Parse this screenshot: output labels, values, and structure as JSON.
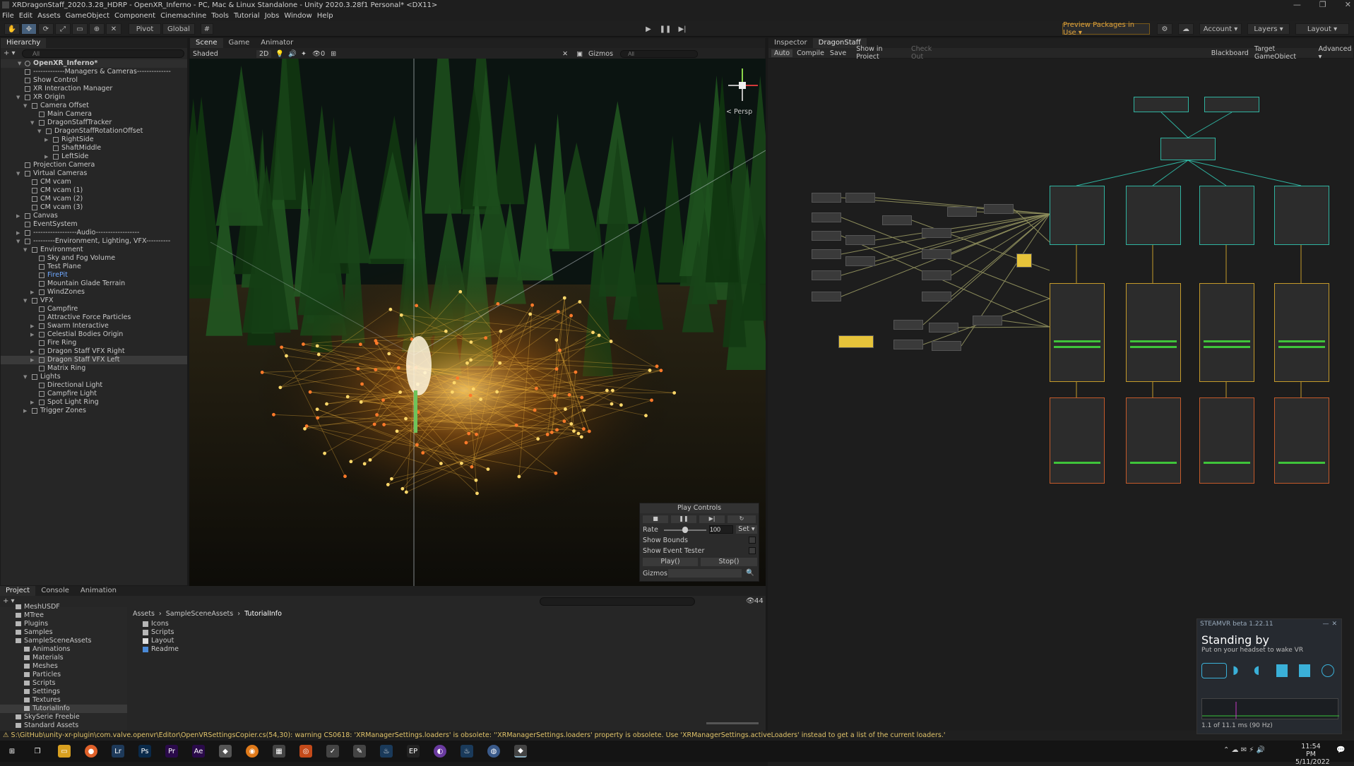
{
  "window": {
    "title": "XRDragonStaff_2020.3.28_HDRP - OpenXR_Inferno - PC, Mac & Linux Standalone - Unity 2020.3.28f1 Personal* <DX11>",
    "controls": [
      "—",
      "❐",
      "✕"
    ]
  },
  "menu": [
    "File",
    "Edit",
    "Assets",
    "GameObject",
    "Component",
    "Cinemachine",
    "Tools",
    "Tutorial",
    "Jobs",
    "Window",
    "Help"
  ],
  "toolbar": {
    "pivot": "Pivot",
    "global": "Global",
    "preview_packages": "Preview Packages in Use ▾",
    "account": "Account",
    "layers": "Layers",
    "layout": "Layout"
  },
  "hierarchy": {
    "tab": "Hierarchy",
    "search_placeholder": "All",
    "scene_name": "OpenXR_Inferno*",
    "items": [
      {
        "label": "-------------Managers & Cameras--------------",
        "depth": 1,
        "arrow": ""
      },
      {
        "label": "Show Control",
        "depth": 1,
        "arrow": ""
      },
      {
        "label": "XR Interaction Manager",
        "depth": 1,
        "arrow": ""
      },
      {
        "label": "XR Origin",
        "depth": 1,
        "arrow": "▼"
      },
      {
        "label": "Camera Offset",
        "depth": 2,
        "arrow": "▼"
      },
      {
        "label": "Main Camera",
        "depth": 3,
        "arrow": ""
      },
      {
        "label": "DragonStaffTracker",
        "depth": 3,
        "arrow": "▼"
      },
      {
        "label": "DragonStaffRotationOffset",
        "depth": 4,
        "arrow": "▼"
      },
      {
        "label": "RightSide",
        "depth": 5,
        "arrow": "▶"
      },
      {
        "label": "ShaftMiddle",
        "depth": 5,
        "arrow": ""
      },
      {
        "label": "LeftSide",
        "depth": 5,
        "arrow": "▶"
      },
      {
        "label": "Projection Camera",
        "depth": 1,
        "arrow": ""
      },
      {
        "label": "Virtual Cameras",
        "depth": 1,
        "arrow": "▼"
      },
      {
        "label": "CM vcam",
        "depth": 2,
        "arrow": ""
      },
      {
        "label": "CM vcam (1)",
        "depth": 2,
        "arrow": ""
      },
      {
        "label": "CM vcam (2)",
        "depth": 2,
        "arrow": ""
      },
      {
        "label": "CM vcam (3)",
        "depth": 2,
        "arrow": ""
      },
      {
        "label": "Canvas",
        "depth": 1,
        "arrow": "▶"
      },
      {
        "label": "EventSystem",
        "depth": 1,
        "arrow": ""
      },
      {
        "label": "------------------Audio------------------",
        "depth": 1,
        "arrow": "▶"
      },
      {
        "label": "---------Environment, Lighting, VFX----------",
        "depth": 1,
        "arrow": "▼"
      },
      {
        "label": "Environment",
        "depth": 2,
        "arrow": "▼"
      },
      {
        "label": "Sky and Fog Volume",
        "depth": 3,
        "arrow": ""
      },
      {
        "label": "Test Plane",
        "depth": 3,
        "arrow": ""
      },
      {
        "label": "FirePit",
        "depth": 3,
        "arrow": "",
        "blue": true
      },
      {
        "label": "Mountain Glade Terrain",
        "depth": 3,
        "arrow": ""
      },
      {
        "label": "WindZones",
        "depth": 3,
        "arrow": "▶"
      },
      {
        "label": "VFX",
        "depth": 2,
        "arrow": "▼"
      },
      {
        "label": "Campfire",
        "depth": 3,
        "arrow": ""
      },
      {
        "label": "Attractive Force Particles",
        "depth": 3,
        "arrow": ""
      },
      {
        "label": "Swarm Interactive",
        "depth": 3,
        "arrow": "▶"
      },
      {
        "label": "Celestial Bodies Origin",
        "depth": 3,
        "arrow": "▶"
      },
      {
        "label": "Fire Ring",
        "depth": 3,
        "arrow": ""
      },
      {
        "label": "Dragon Staff VFX Right",
        "depth": 3,
        "arrow": "▶"
      },
      {
        "label": "Dragon Staff VFX Left",
        "depth": 3,
        "arrow": "▶",
        "selected": true
      },
      {
        "label": "Matrix Ring",
        "depth": 3,
        "arrow": ""
      },
      {
        "label": "Lights",
        "depth": 2,
        "arrow": "▼"
      },
      {
        "label": "Directional Light",
        "depth": 3,
        "arrow": ""
      },
      {
        "label": "Campfire Light",
        "depth": 3,
        "arrow": ""
      },
      {
        "label": "Spot Light Ring",
        "depth": 3,
        "arrow": "▶"
      },
      {
        "label": "Trigger Zones",
        "depth": 2,
        "arrow": "▶"
      }
    ]
  },
  "scene": {
    "tabs": [
      "Scene",
      "Game",
      "Animator"
    ],
    "shading": "Shaded",
    "mode_2d": "2D",
    "gizmos": "Gizmos",
    "search_placeholder": "All",
    "persp": "< Persp",
    "hidden_count": "0"
  },
  "play_controls": {
    "title": "Play Controls",
    "rate_label": "Rate",
    "rate_value": "100",
    "set": "Set ▾",
    "show_bounds": "Show Bounds",
    "show_event_tester": "Show Event Tester",
    "play": "Play()",
    "stop": "Stop()",
    "gizmos": "Gizmos"
  },
  "inspector": {
    "tabs": [
      "Inspector",
      "DragonStaff"
    ],
    "actions": [
      "Auto",
      "Compile",
      "Save",
      "Show in Project",
      "Check Out"
    ],
    "right_actions": [
      "Blackboard",
      "Target GameObject",
      "Advanced ▾"
    ]
  },
  "project": {
    "tabs": [
      "Project",
      "Console",
      "Animation"
    ],
    "hidden_count": "44",
    "tree": [
      "MeshUSDF",
      "MTree",
      "Plugins",
      "Samples",
      "SampleSceneAssets",
      "Animations",
      "Materials",
      "Meshes",
      "Particles",
      "Scripts",
      "Settings",
      "Textures",
      "TutorialInfo",
      "SkySerie Freebie",
      "Standard Assets"
    ],
    "breadcrumb": [
      "Assets",
      "SampleSceneAssets",
      "TutorialInfo"
    ],
    "files": [
      "Icons",
      "Scripts",
      "Layout",
      "Readme"
    ]
  },
  "console_message": "S:\\GitHub\\unity-xr-plugin\\com.valve.openvr\\Editor\\OpenVRSettingsCopier.cs(54,30): warning CS0618: 'XRManagerSettings.loaders' is obsolete: ''XRManagerSettings.loaders' property is obsolete. Use 'XRManagerSettings.activeLoaders' instead to get a list of the current loaders.'",
  "steamvr": {
    "header": "STEAMVR beta 1.22.11",
    "status": "Standing by",
    "sub": "Put on your headset to wake VR",
    "frame": "1.1 of 11.1 ms (90 Hz)"
  },
  "taskbar": {
    "time": "11:54 PM",
    "date": "5/11/2022"
  }
}
